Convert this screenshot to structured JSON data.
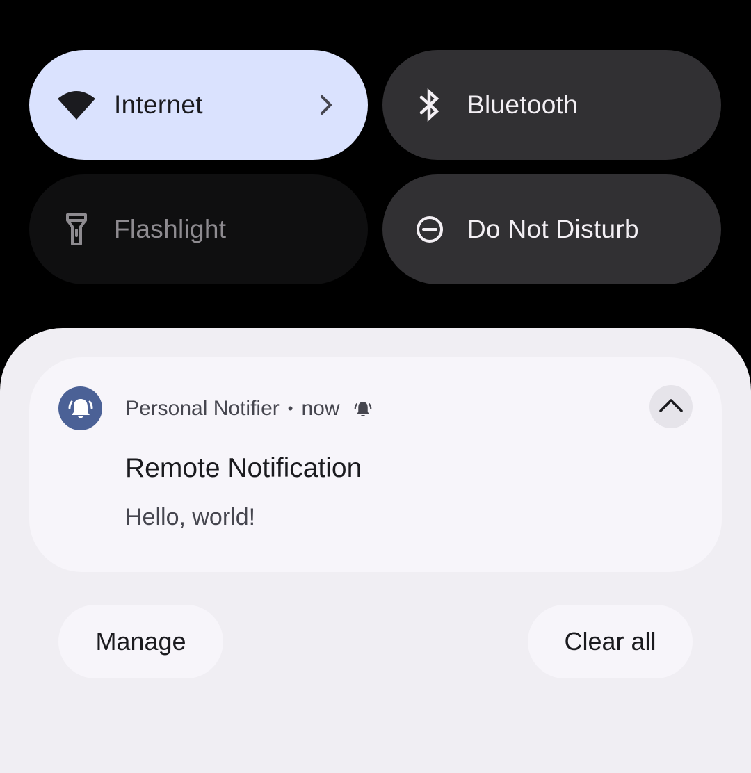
{
  "quick_settings": {
    "tiles": [
      {
        "label": "Internet",
        "icon": "wifi-icon",
        "state": "on",
        "has_chevron": true
      },
      {
        "label": "Bluetooth",
        "icon": "bluetooth-icon",
        "state": "off"
      },
      {
        "label": "Flashlight",
        "icon": "flashlight-icon",
        "state": "unavailable"
      },
      {
        "label": "Do Not Disturb",
        "icon": "do-not-disturb-icon",
        "state": "off"
      }
    ]
  },
  "notification": {
    "app_name": "Personal Notifier",
    "separator": "•",
    "time": "now",
    "app_icon": "bell-icon",
    "alert_icon": "alert-bell-icon",
    "expand_icon": "chevron-up-icon",
    "title": "Remote Notification",
    "body": "Hello, world!"
  },
  "footer": {
    "manage_label": "Manage",
    "clear_all_label": "Clear all"
  },
  "colors": {
    "active_tile": "#dae2fe",
    "inactive_tile": "#313033",
    "unavailable_tile": "#0f0f10",
    "shade_background": "#f0eef3",
    "card_background": "#f7f5fa",
    "app_icon_background": "#4b6196"
  }
}
